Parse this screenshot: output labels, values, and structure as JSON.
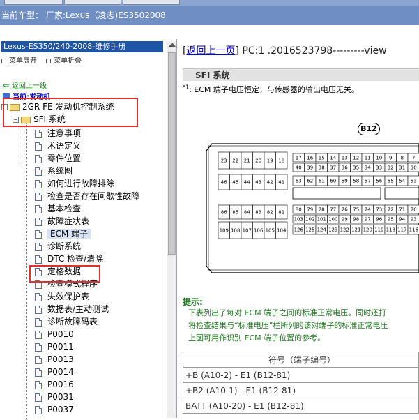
{
  "vehicle": {
    "label": "当前车型： 厂家:Lexus（凌志)ES3502008"
  },
  "manual": {
    "title": "Lexus-ES350/240-2008-维修手册",
    "expand_label": "菜单展开",
    "collapse_label": "菜单折叠"
  },
  "nav": {
    "back_label": "返回上一级",
    "current_label": "当前:发动机"
  },
  "tree": {
    "root": "2GR-FE 发动机控制系统",
    "sub": "SFI 系统",
    "items": [
      "注意事项",
      "术语定义",
      "零件位置",
      "系统图",
      "如何进行故障排除",
      "检查是否存在间歇性故障",
      "基本检查",
      "故障症状表",
      "ECM 端子",
      "诊断系统",
      "DTC 检查/清除",
      "定格数据",
      "检查模式程序",
      "失效保护表",
      "数据表/主动测试",
      "诊断故障码表",
      "P0010",
      "P0011",
      "P0013",
      "P0014",
      "P0016",
      "P0031",
      "P0037"
    ]
  },
  "content": {
    "back_link": "返回上一页",
    "pc_label": " PC:1 .2016523798---------view",
    "section_title": "SFI 系统",
    "note_marker": "*1",
    "note_text": ": ECM 端子电压恒定，与传感器的输出电压无关。",
    "connector_name": "B12",
    "tip_label": "提示:",
    "tip_lines": [
      "下表列出了每对 ECM 端子之间的标准正常电压。同时还打",
      "将检查结果与“标准电压”栏所列的该对端子的标准正常电压",
      "上图可用作识别 ECM 端子位置的参考。"
    ],
    "table": {
      "header": "符号（端子编号）",
      "rows": [
        "+B (A10-2) - E1 (B12-81)",
        "+B2 (A10-1) - E1 (B12-81)",
        "BATT (A10-20) - E1 (B12-81)"
      ]
    }
  },
  "connector": {
    "row1_left": [
      "23",
      "22",
      "21",
      "20",
      "19",
      "18"
    ],
    "row1_right": [
      "17",
      "16",
      "15",
      "14",
      "13",
      "12",
      "11",
      "10",
      "9",
      "8",
      "7",
      "6"
    ],
    "row2_right": [
      "40",
      "39",
      "38",
      "37",
      "36",
      "35",
      "34",
      "33",
      "32",
      "31",
      "30",
      "29"
    ],
    "row3_left": [
      "46",
      "45",
      "44",
      "43",
      "42",
      "41"
    ],
    "row3_right": [
      "63",
      "62",
      "61",
      "60",
      "59",
      "58",
      "57",
      "56",
      "55",
      "54",
      "53",
      "52"
    ],
    "row4_left": [
      "86",
      "85",
      "84",
      "83",
      "82",
      "81"
    ],
    "row4_right": [
      "80",
      "79",
      "78",
      "77",
      "76",
      "75",
      "74",
      "73",
      "72",
      "71",
      "70",
      "69"
    ],
    "row5_right": [
      "103",
      "102",
      "101",
      "100",
      "99",
      "98",
      "97",
      "96",
      "95",
      "94",
      "93",
      "92"
    ],
    "row6_left": [
      "109",
      "108",
      "107",
      "106",
      "105",
      "104"
    ],
    "row6_right": [
      "126",
      "125",
      "124",
      "123",
      "122",
      "121",
      "120",
      "119",
      "118",
      "117",
      "116",
      "115"
    ]
  }
}
